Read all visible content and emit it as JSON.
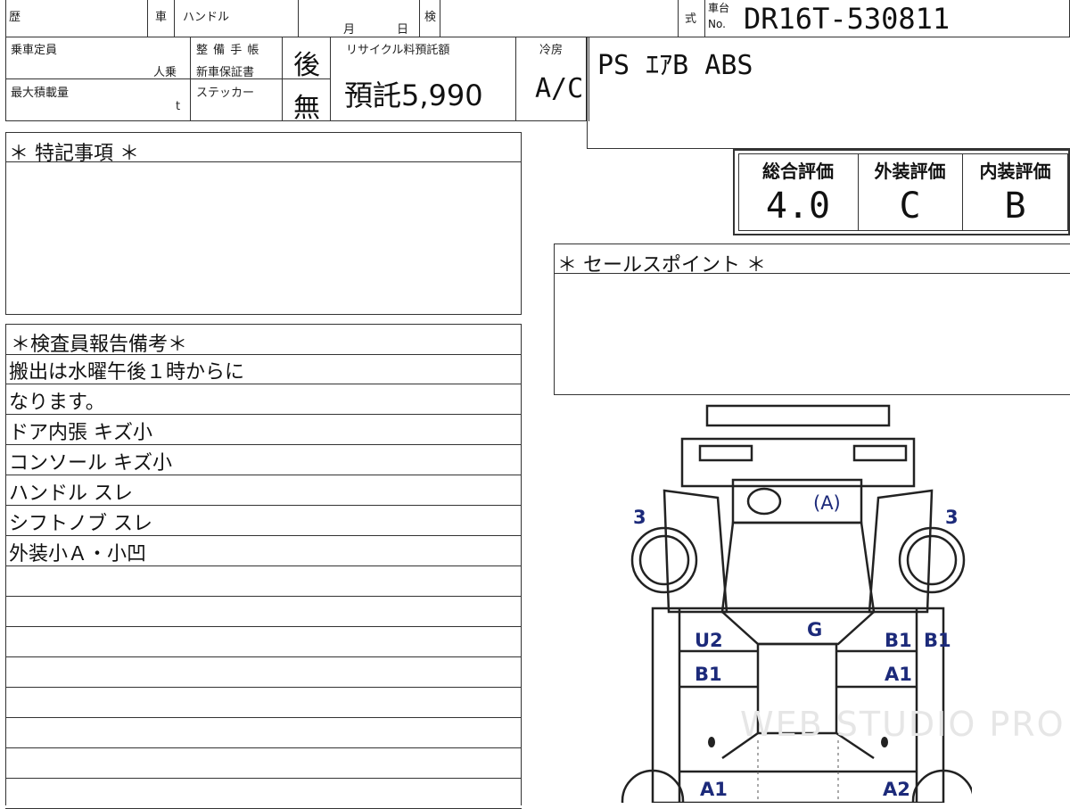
{
  "header": {
    "history_label": "歴",
    "car_label": "車",
    "handle_label": "ハンドル",
    "month_label": "月",
    "day_label": "日",
    "inspection_label": "検",
    "type_label": "式",
    "chassis_label_top": "車台",
    "chassis_label_bottom": "No.",
    "chassis_no": "DR16T-530811"
  },
  "row2": {
    "capacity_label": "乗車定員",
    "capacity_unit": "人乗",
    "maintenance_label": "整 備 手 帳",
    "warranty_label": "新車保証書",
    "maintenance_value": "後",
    "recycle_label": "リサイクル料預託額",
    "recycle_value": "預託5,990",
    "ac_label": "冷房",
    "ac_value": "A/C",
    "equipment": "PS ｴｱB ABS"
  },
  "row3": {
    "max_load_label": "最大積載量",
    "max_load_unit": "t",
    "sticker_label": "ステッカー",
    "sticker_value": "無"
  },
  "special_notes": {
    "title": "＊ 特記事項 ＊"
  },
  "ratings": {
    "overall_label": "総合評価",
    "overall_value": "4.0",
    "exterior_label": "外装評価",
    "exterior_value": "C",
    "interior_label": "内装評価",
    "interior_value": "B"
  },
  "sales_points": {
    "title": "＊ セールスポイント ＊"
  },
  "inspector_remarks": {
    "title": "＊検査員報告備考＊",
    "lines": [
      "搬出は水曜午後１時からに",
      "なります。",
      "ドア内張 キズ小",
      "コンソール キズ小",
      "ハンドル スレ",
      "シフトノブ スレ",
      "外装小Ａ・小凹"
    ]
  },
  "diagram": {
    "labels": {
      "front_left_tire": "3",
      "front_right_tire": "3",
      "hood": "(A)",
      "windshield": "G",
      "left_u2": "U2",
      "left_b1": "B1",
      "right_b1_a": "B1",
      "right_b1_b": "B1",
      "right_a1": "A1",
      "rear_left_a1": "A1",
      "rear_right_a2": "A2"
    }
  },
  "watermark": "WEB STUDIO PRO"
}
